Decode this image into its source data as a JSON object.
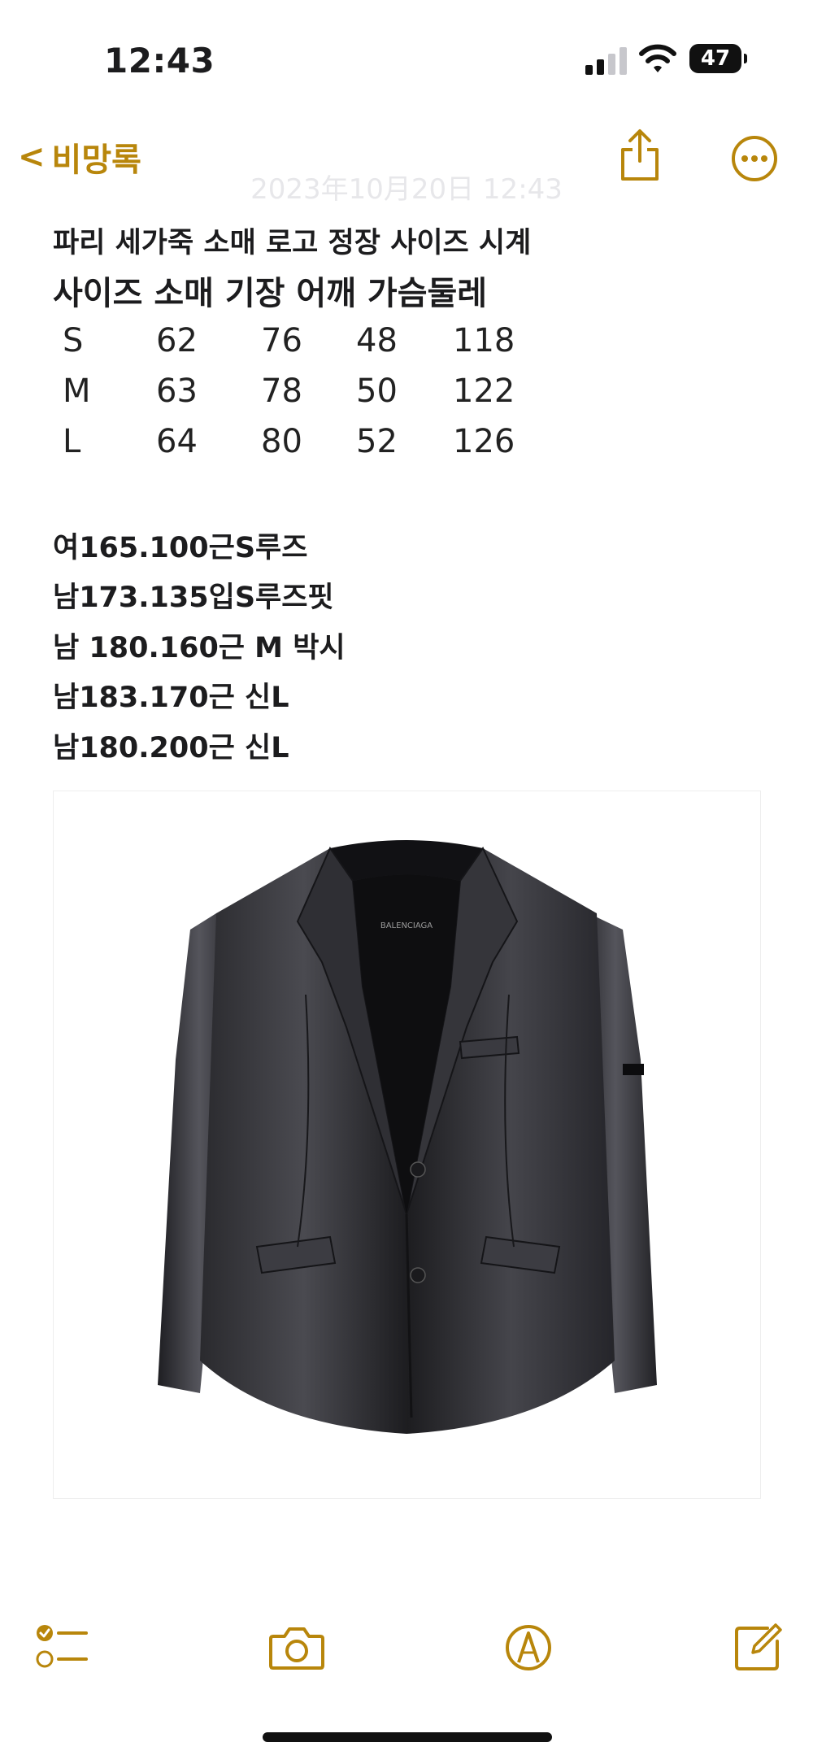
{
  "status_bar": {
    "time": "12:43",
    "battery": "47"
  },
  "nav": {
    "back_label": "비망록",
    "back_chevron": "<"
  },
  "note": {
    "date": "2023年10月20日 12:43",
    "title": "파리 세가죽 소매 로고 정장 사이즈 시계",
    "table_header": "사이즈 소매 기장 어깨 가슴둘레",
    "size_rows": [
      {
        "size": "S",
        "sleeve": "62",
        "length": "76",
        "shoulder": "48",
        "chest": "118"
      },
      {
        "size": "M",
        "sleeve": "63",
        "length": "78",
        "shoulder": "50",
        "chest": "122"
      },
      {
        "size": "L",
        "sleeve": "64",
        "length": "80",
        "shoulder": "52",
        "chest": "126"
      }
    ],
    "fit_notes": [
      "여165.100근S루즈",
      "남173.135입S루즈핏",
      "남 180.160근 M 박시",
      "남183.170근 신L",
      "남180.200근 신L"
    ],
    "image": {
      "brand_label": "BALENCIAGA",
      "subject": "black leather blazer"
    }
  },
  "toolbar": {
    "checklist_icon": "checklist-icon",
    "camera_icon": "camera-icon",
    "markup_icon": "markup-pen-icon",
    "compose_icon": "compose-icon"
  },
  "colors": {
    "accent": "#b8860b",
    "text": "#1c1c1e"
  }
}
